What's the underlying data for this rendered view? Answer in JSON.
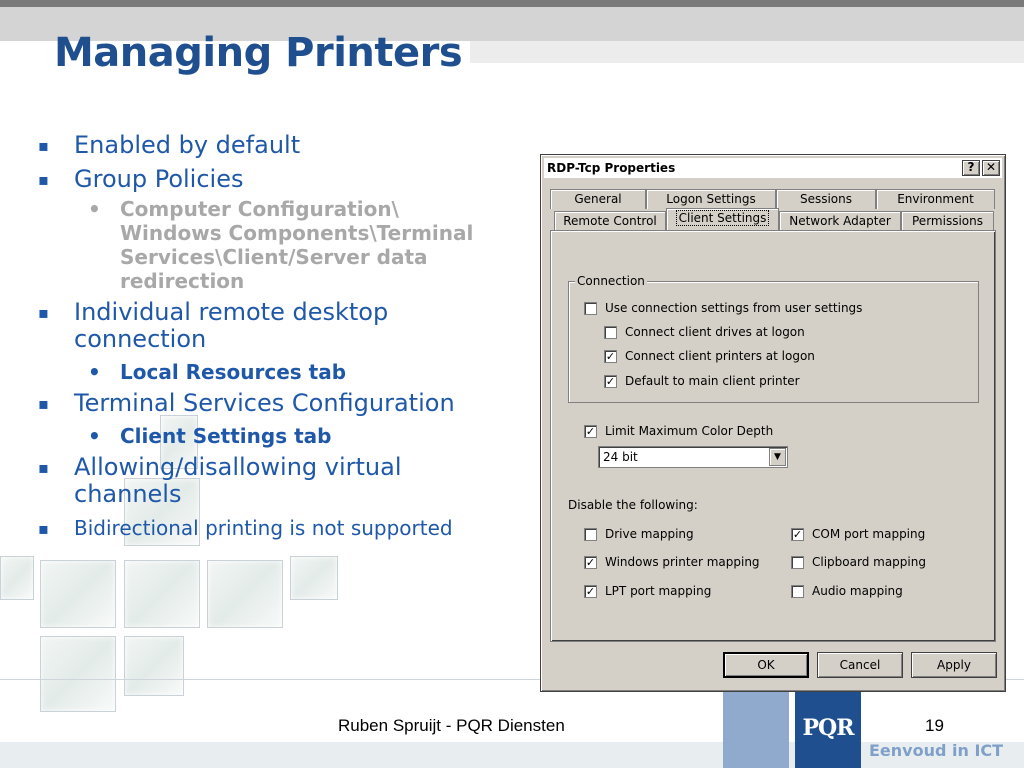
{
  "slide": {
    "title": "Managing Printers",
    "bullets": [
      {
        "text": "Enabled by default"
      },
      {
        "text": "Group Policies"
      },
      {
        "text": "Computer Configuration\\ Windows Components\\Terminal Services\\Client/Server data redirection"
      },
      {
        "text": "Individual remote desktop connection"
      },
      {
        "text": "Local Resources tab"
      },
      {
        "text": "Terminal Services Configuration"
      },
      {
        "text": "Client Settings tab"
      },
      {
        "text": "Allowing/disallowing virtual channels"
      },
      {
        "text": "Bidirectional printing is not supported"
      }
    ],
    "footer": {
      "author": "Ruben Spruijt - PQR Diensten",
      "page": "19"
    },
    "logo": {
      "text": "PQR",
      "tagline": "Eenvoud in ICT"
    }
  },
  "dialog": {
    "title": "RDP-Tcp Properties",
    "help_glyph": "?",
    "close_glyph": "✕",
    "tabs_row1": [
      "General",
      "Logon Settings",
      "Sessions",
      "Environment"
    ],
    "tabs_row2": [
      "Remote Control",
      "Client Settings",
      "Network Adapter",
      "Permissions"
    ],
    "active_tab": "Client Settings",
    "connection_group": {
      "label": "Connection",
      "options": [
        {
          "label": "Use connection settings from user settings",
          "checked": false
        },
        {
          "label": "Connect client drives at logon",
          "checked": false
        },
        {
          "label": "Connect client printers at logon",
          "checked": true
        },
        {
          "label": "Default to main client printer",
          "checked": true
        }
      ]
    },
    "color_depth": {
      "label": "Limit Maximum Color Depth",
      "checked": true,
      "value": "24 bit"
    },
    "disable_label": "Disable the following:",
    "disable_options": [
      {
        "label": "Drive mapping",
        "checked": false
      },
      {
        "label": "COM port mapping",
        "checked": true
      },
      {
        "label": "Windows printer mapping",
        "checked": true
      },
      {
        "label": "Clipboard mapping",
        "checked": false
      },
      {
        "label": "LPT port mapping",
        "checked": true
      },
      {
        "label": "Audio mapping",
        "checked": false
      }
    ],
    "buttons": {
      "ok": "OK",
      "cancel": "Cancel",
      "apply": "Apply"
    }
  }
}
